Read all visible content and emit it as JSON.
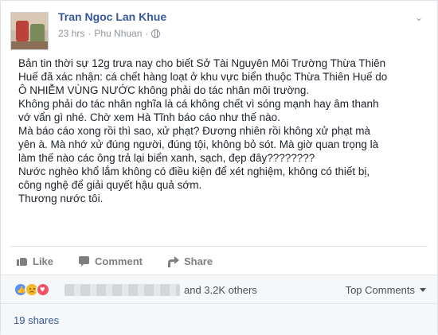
{
  "post": {
    "author": "Tran Ngoc Lan Khue",
    "time": "23 hrs",
    "separator": "·",
    "location": "Phu Nhuan",
    "privacy_icon": "globe-icon",
    "menu_icon": "chevron-down-icon",
    "lines": [
      "Bản tin thời sự 12g trưa nay cho biết Sở Tài Nguyên Môi Trường Thừa Thiên",
      "Huế đã xác nhận: cá chết hàng loạt ở khu vực biển thuộc Thừa Thiên Huế do",
      "Ô NHIỄM VÙNG NƯỚC không phải do tác nhân môi trường.",
      "Không phải do tác nhân nghĩa là cá không chết vì sóng mạnh hay âm thanh",
      "vớ vẩn gì nhé. Chờ xem Hà Tĩnh báo cáo như thế nào.",
      "Mà báo cáo xong rồi thì sao, xử phạt? Đương nhiên rồi không xử phạt mà",
      "yên à. Mà nhớ xử đúng người, đúng tội, không bỏ sót. Mà giờ quan trọng là",
      "làm thế nào các ông trả lại biển xanh, sạch, đẹp đây????????",
      "Nước nghèo khổ lắm không có điều kiện để xét nghiệm, không có thiết bị,",
      "công nghệ để giải quyết hậu quả sớm.",
      "Thương nước tôi."
    ]
  },
  "actions": {
    "like": "Like",
    "comment": "Comment",
    "share": "Share"
  },
  "reactions": {
    "types": [
      "like",
      "sad",
      "love"
    ],
    "others_text": "and 3.2K others",
    "sort_label": "Top Comments"
  },
  "shares": "19 shares",
  "colors": {
    "link": "#365899",
    "muted": "#90949c",
    "action": "#7f7f7f"
  }
}
